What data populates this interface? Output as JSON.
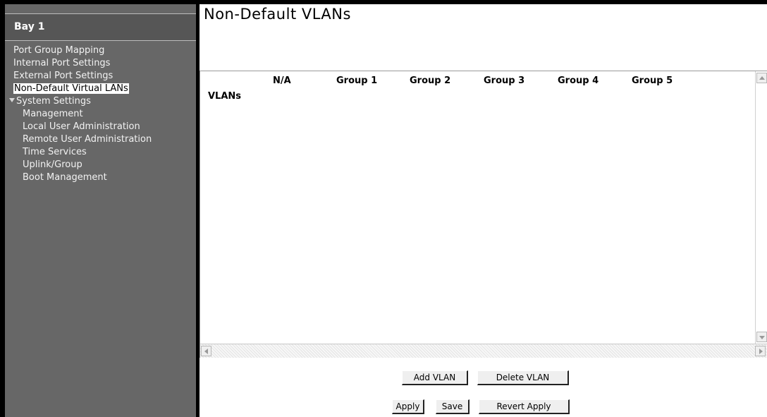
{
  "sidebar": {
    "bay_title": "Bay 1",
    "items": [
      {
        "label": "Port Group Mapping"
      },
      {
        "label": "Internal Port Settings"
      },
      {
        "label": "External Port Settings"
      },
      {
        "label": "Non-Default Virtual LANs",
        "selected": true
      },
      {
        "label": "System Settings",
        "expanded": true
      },
      {
        "label": "Management"
      },
      {
        "label": "Local User Administration"
      },
      {
        "label": "Remote User Administration"
      },
      {
        "label": "Time Services"
      },
      {
        "label": "Uplink/Group"
      },
      {
        "label": "Boot Management"
      }
    ]
  },
  "main": {
    "title": "Non-Default VLANs",
    "table": {
      "row_header": "VLANs",
      "columns": [
        "N/A",
        "Group 1",
        "Group 2",
        "Group 3",
        "Group 4",
        "Group 5"
      ]
    },
    "buttons": {
      "add_vlan": "Add VLAN",
      "delete_vlan": "Delete VLAN",
      "apply": "Apply",
      "save": "Save",
      "revert_apply": "Revert Apply"
    }
  },
  "colors": {
    "sidebar_bg": "#676767",
    "sidebar_header_bg": "#565656",
    "selected_bg": "#ffffff",
    "button_bg": "#efefef"
  }
}
